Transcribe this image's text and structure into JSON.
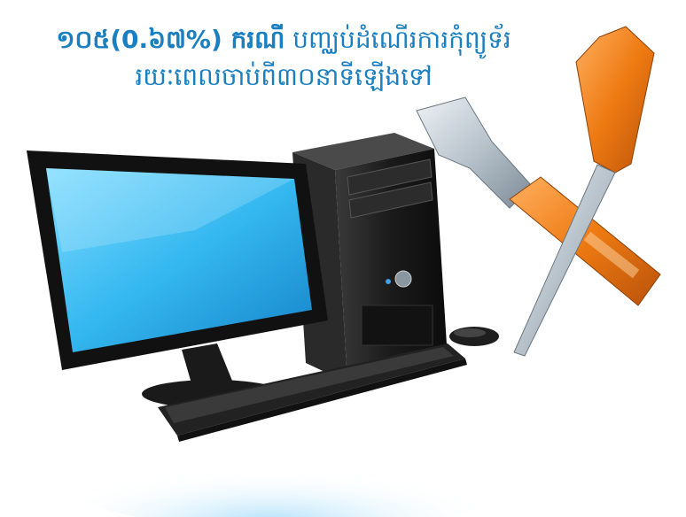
{
  "headline": {
    "bold_part": "១០៥(0.៦៧%) ករណី",
    "rest_of_line1": "បញ្ឈប់ដំណើរការកុំព្យូទ័រ",
    "line2": "រយៈពេលចាប់ពី៣០នាទីឡើងទៅ"
  },
  "colors": {
    "headline": "#1a7fc0",
    "screen": "#35b8f0",
    "tool_orange": "#e8770e",
    "tool_steel": "#b8c3cc",
    "hardware": "#1c1c1c"
  },
  "icons": [
    "computer-monitor-icon",
    "computer-tower-icon",
    "keyboard-icon",
    "mouse-icon",
    "wrench-icon",
    "screwdriver-icon"
  ]
}
